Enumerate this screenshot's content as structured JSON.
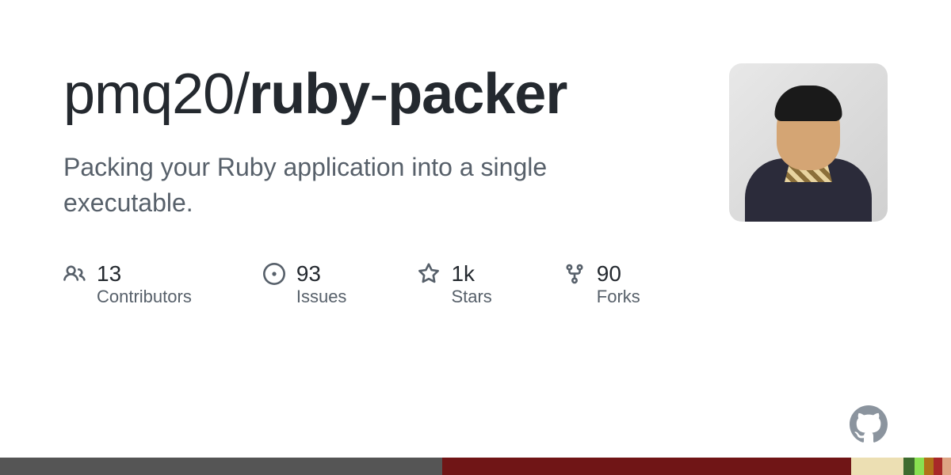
{
  "repo": {
    "owner": "pmq20",
    "separator": "/",
    "name_part1": "ruby",
    "name_hyphen": "-",
    "name_part2": "packer"
  },
  "description": "Packing your Ruby application into a single executable.",
  "stats": {
    "contributors": {
      "value": "13",
      "label": "Contributors"
    },
    "issues": {
      "value": "93",
      "label": "Issues"
    },
    "stars": {
      "value": "1k",
      "label": "Stars"
    },
    "forks": {
      "value": "90",
      "label": "Forks"
    }
  },
  "language_bar": [
    {
      "color": "#555555",
      "width": "46.5%"
    },
    {
      "color": "#701516",
      "width": "43%"
    },
    {
      "color": "#ecdfb3",
      "width": "5.5%"
    },
    {
      "color": "#3e6b2f",
      "width": "1.2%"
    },
    {
      "color": "#89e051",
      "width": "1.0%"
    },
    {
      "color": "#b07219",
      "width": "1.0%"
    },
    {
      "color": "#a82828",
      "width": "0.9%"
    },
    {
      "color": "#dea584",
      "width": "0.9%"
    }
  ]
}
